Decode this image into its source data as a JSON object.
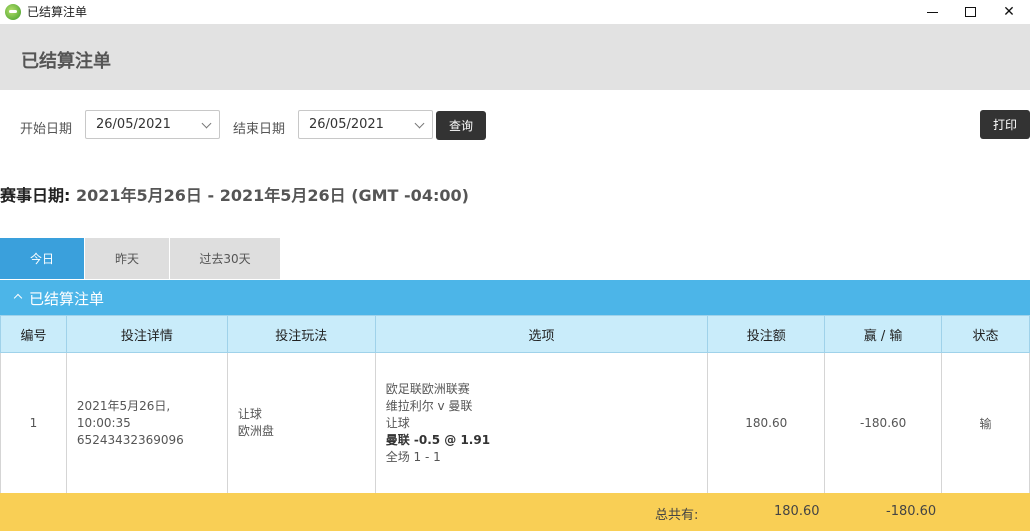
{
  "window": {
    "title": "已结算注单"
  },
  "header": {
    "title": "已结算注单"
  },
  "filters": {
    "start_label": "开始日期",
    "start_value": "26/05/2021",
    "end_label": "结束日期",
    "end_value": "26/05/2021",
    "query_label": "查询",
    "print_label": "打印"
  },
  "event_dates": {
    "label": "赛事日期:",
    "range": " 2021年5月26日 - 2021年5月26日 (GMT -04:00)"
  },
  "tabs": [
    {
      "label": "今日",
      "active": true
    },
    {
      "label": "昨天",
      "active": false
    },
    {
      "label": "过去30天",
      "active": false
    }
  ],
  "section": {
    "title": "已结算注单"
  },
  "table": {
    "headers": [
      "编号",
      "投注详情",
      "投注玩法",
      "选项",
      "投注额",
      "赢 / 输",
      "状态"
    ],
    "rows": [
      {
        "id": "1",
        "detail_date": "2021年5月26日,",
        "detail_time": "10:00:35",
        "detail_ref": "65243432369096",
        "play_type": "让球",
        "play_market": "欧洲盘",
        "opt_league": "欧足联欧洲联赛",
        "opt_match": "维拉利尔 v 曼联",
        "opt_market": "让球",
        "opt_pick": "曼联 -0.5 @ 1.91",
        "opt_period": "全场 1 - 1",
        "stake": "180.60",
        "win_loss": "-180.60",
        "status": "输"
      }
    ]
  },
  "totals": {
    "label": "总共有:",
    "stake": "180.60",
    "win_loss": "-180.60"
  }
}
